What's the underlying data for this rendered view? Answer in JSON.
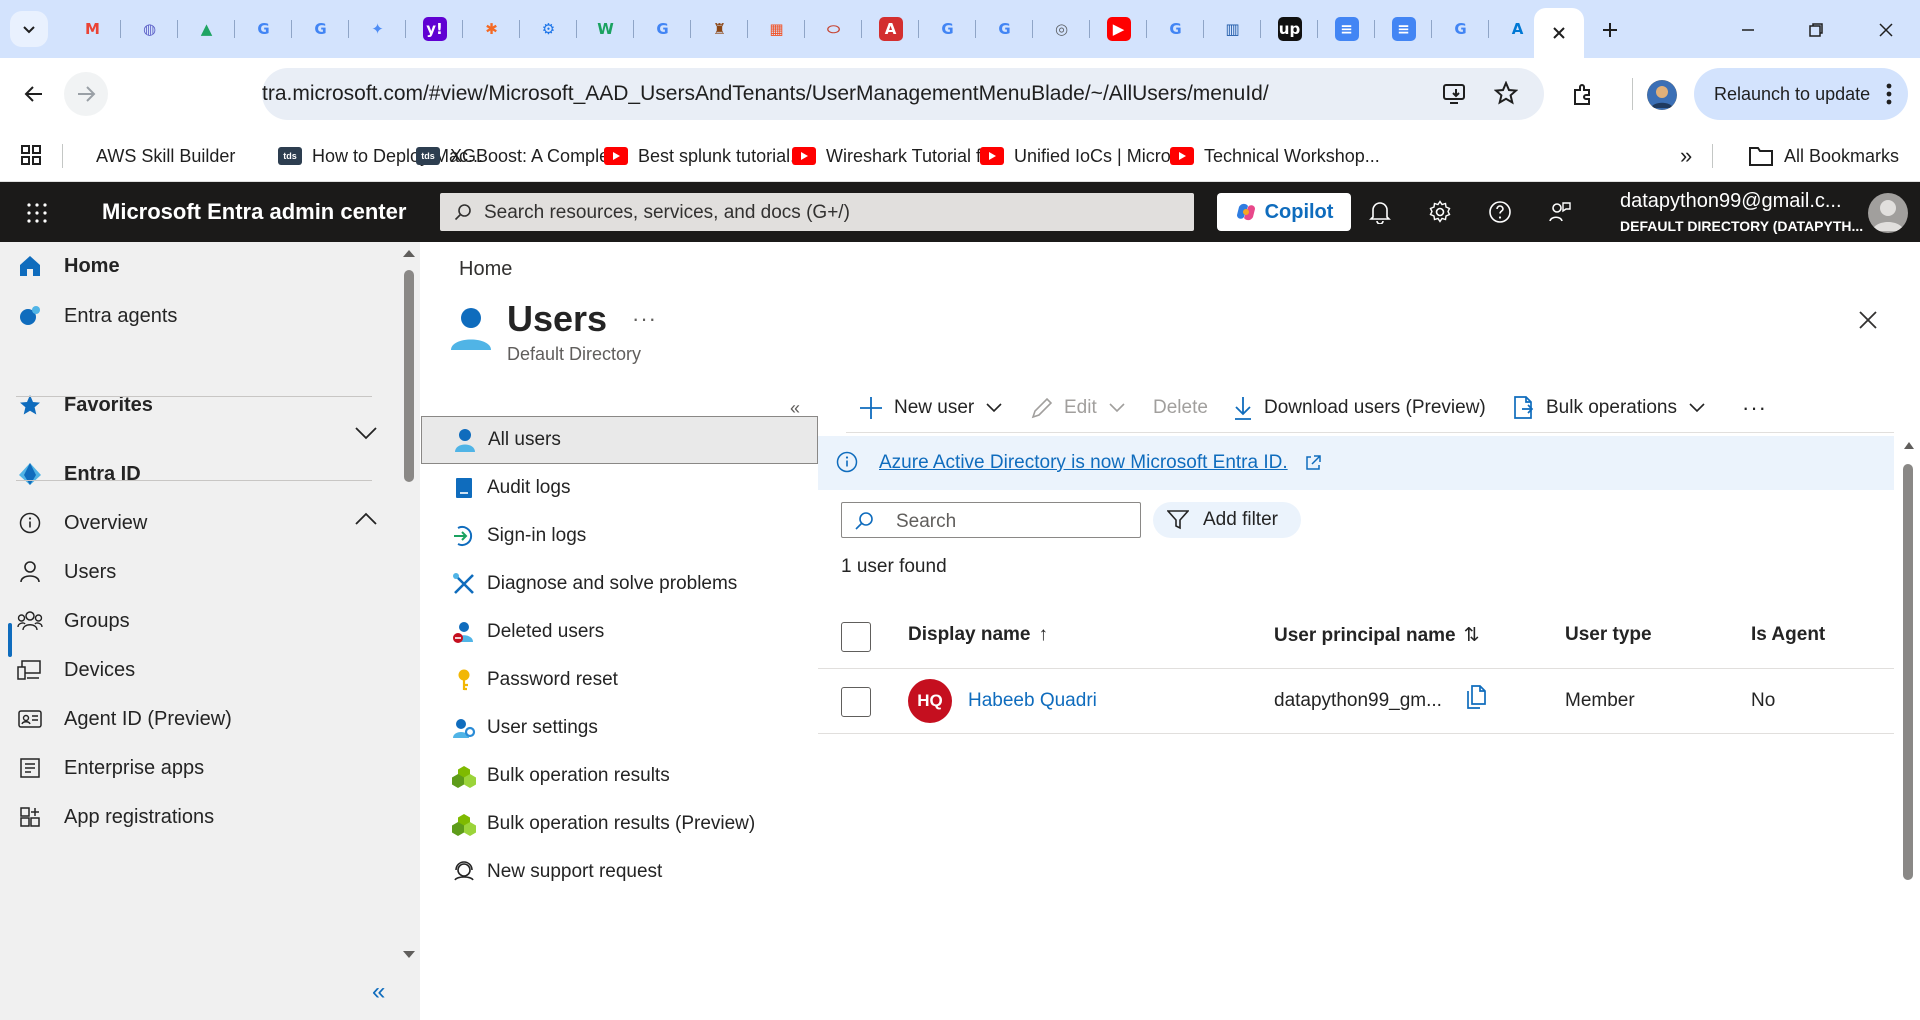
{
  "browser": {
    "tab_favicons": [
      {
        "name": "gmail-icon",
        "glyph": "M",
        "color": "#ea4335",
        "bg": "transparent"
      },
      {
        "name": "globe-icon",
        "glyph": "◍",
        "color": "#5b5fc7",
        "bg": "transparent"
      },
      {
        "name": "google-drive-icon",
        "glyph": "▲",
        "color": "#1fa463",
        "bg": "transparent"
      },
      {
        "name": "google-icon",
        "glyph": "G",
        "color": "#4285f4",
        "bg": "transparent"
      },
      {
        "name": "google-icon",
        "glyph": "G",
        "color": "#4285f4",
        "bg": "transparent"
      },
      {
        "name": "gemini-icon",
        "glyph": "✦",
        "color": "#4f8df5",
        "bg": "transparent"
      },
      {
        "name": "yahoo-icon",
        "glyph": "y!",
        "color": "#ffffff",
        "bg": "#6001d2"
      },
      {
        "name": "puzzle-orange-icon",
        "glyph": "✱",
        "color": "#f46a25",
        "bg": "transparent"
      },
      {
        "name": "settings-blue-icon",
        "glyph": "⚙",
        "color": "#1a73e8",
        "bg": "transparent"
      },
      {
        "name": "w3-icon",
        "glyph": "W",
        "color": "#1aa260",
        "bg": "transparent"
      },
      {
        "name": "google-icon",
        "glyph": "G",
        "color": "#4285f4",
        "bg": "transparent"
      },
      {
        "name": "figure-icon",
        "glyph": "♜",
        "color": "#8b4513",
        "bg": "transparent"
      },
      {
        "name": "microsoft-icon",
        "glyph": "▦",
        "color": "#f25022",
        "bg": "transparent"
      },
      {
        "name": "oracle-icon",
        "glyph": "⬭",
        "color": "#c74634",
        "bg": "transparent"
      },
      {
        "name": "pdf-icon",
        "glyph": "A",
        "color": "#ffffff",
        "bg": "#d32f2f"
      },
      {
        "name": "google-icon",
        "glyph": "G",
        "color": "#4285f4",
        "bg": "transparent"
      },
      {
        "name": "google-lens-icon",
        "glyph": "G",
        "color": "#4285f4",
        "bg": "transparent"
      },
      {
        "name": "chrome-icon",
        "glyph": "◎",
        "color": "#5f6368",
        "bg": "transparent"
      },
      {
        "name": "youtube-icon",
        "glyph": "▶",
        "color": "#ffffff",
        "bg": "#ff0000"
      },
      {
        "name": "google-icon",
        "glyph": "G",
        "color": "#4285f4",
        "bg": "transparent"
      },
      {
        "name": "kaggle-icon",
        "glyph": "▥",
        "color": "#1e5aa8",
        "bg": "transparent"
      },
      {
        "name": "upwork-icon",
        "glyph": "up",
        "color": "#ffffff",
        "bg": "#111111"
      },
      {
        "name": "google-docs-icon",
        "glyph": "≡",
        "color": "#ffffff",
        "bg": "#4285f4"
      },
      {
        "name": "google-docs-icon",
        "glyph": "≡",
        "color": "#ffffff",
        "bg": "#4285f4"
      },
      {
        "name": "google-icon",
        "glyph": "G",
        "color": "#4285f4",
        "bg": "transparent"
      },
      {
        "name": "azure-icon",
        "glyph": "A",
        "color": "#0078d4",
        "bg": "transparent"
      }
    ],
    "url": "tra.microsoft.com/#view/Microsoft_AAD_UsersAndTenants/UserManagementMenuBlade/~/AllUsers/menuId/",
    "relaunch_label": "Relaunch to update",
    "bookmarks": [
      {
        "label": "AWS Skill Builder",
        "icon": "none",
        "color": ""
      },
      {
        "label": "How to Deploy Mac...",
        "icon": "tds",
        "color": "#2d3e50"
      },
      {
        "label": "XGBoost: A Comple...",
        "icon": "tds",
        "color": "#2d3e50"
      },
      {
        "label": "Best splunk tutorial...",
        "icon": "youtube",
        "color": "#ff0000"
      },
      {
        "label": "Wireshark Tutorial f...",
        "icon": "youtube",
        "color": "#ff0000"
      },
      {
        "label": "Unified IoCs | Micro...",
        "icon": "youtube",
        "color": "#ff0000"
      },
      {
        "label": "Technical Workshop...",
        "icon": "youtube",
        "color": "#ff0000"
      }
    ],
    "bookmarks_more": "»",
    "all_bookmarks_label": "All Bookmarks"
  },
  "portal": {
    "title": "Microsoft Entra admin center",
    "search_placeholder": "Search resources, services, and docs (G+/)",
    "copilot_label": "Copilot",
    "account_name": "datapython99@gmail.c...",
    "account_directory": "DEFAULT DIRECTORY (DATAPYTH..."
  },
  "leftnav": {
    "items": [
      {
        "label": "Home",
        "icon": "home-icon",
        "bold": true
      },
      {
        "label": "Entra agents",
        "icon": "entra-agents-icon",
        "bold": false
      },
      {
        "label": "Favorites",
        "icon": "star-icon",
        "bold": true
      },
      {
        "label": "Entra ID",
        "icon": "entra-id-icon",
        "bold": true
      },
      {
        "label": "Overview",
        "icon": "info-icon",
        "bold": false
      },
      {
        "label": "Users",
        "icon": "user-icon",
        "bold": false
      },
      {
        "label": "Groups",
        "icon": "groups-icon",
        "bold": false
      },
      {
        "label": "Devices",
        "icon": "devices-icon",
        "bold": false
      },
      {
        "label": "Agent ID (Preview)",
        "icon": "agent-id-icon",
        "bold": false
      },
      {
        "label": "Enterprise apps",
        "icon": "enterprise-apps-icon",
        "bold": false
      },
      {
        "label": "App registrations",
        "icon": "app-registrations-icon",
        "bold": false
      }
    ],
    "selected": "Users",
    "collapse_glyph": "«"
  },
  "blade": {
    "breadcrumb": "Home",
    "title": "Users",
    "subtitle": "Default Directory",
    "more_glyph": "···",
    "menu": [
      {
        "label": "All users",
        "icon": "all-users-icon"
      },
      {
        "label": "Audit logs",
        "icon": "audit-logs-icon"
      },
      {
        "label": "Sign-in logs",
        "icon": "sign-in-logs-icon"
      },
      {
        "label": "Diagnose and solve problems",
        "icon": "diagnose-icon"
      },
      {
        "label": "Deleted users",
        "icon": "deleted-users-icon"
      },
      {
        "label": "Password reset",
        "icon": "password-reset-icon"
      },
      {
        "label": "User settings",
        "icon": "user-settings-icon"
      },
      {
        "label": "Bulk operation results",
        "icon": "bulk-results-icon"
      },
      {
        "label": "Bulk operation results (Preview)",
        "icon": "bulk-results-preview-icon"
      },
      {
        "label": "New support request",
        "icon": "support-request-icon"
      }
    ],
    "menu_selected": "All users",
    "menu_collapse_glyph": "«",
    "commands": {
      "new_user": "New user",
      "edit": "Edit",
      "delete": "Delete",
      "download": "Download users (Preview)",
      "bulk": "Bulk operations",
      "more": "···"
    },
    "banner_link": "Azure Active Directory is now Microsoft Entra ID.",
    "search_placeholder": "Search",
    "add_filter": "Add filter",
    "result_count": "1 user found",
    "columns": {
      "display_name": "Display name",
      "display_name_sort": "↑",
      "upn": "User principal name",
      "upn_sort": "⇅",
      "user_type": "User type",
      "is_agent": "Is Agent"
    },
    "rows": [
      {
        "initials": "HQ",
        "display_name": "Habeeb Quadri",
        "upn": "datapython99_gm...",
        "user_type": "Member",
        "is_agent": "No"
      }
    ]
  },
  "colors": {
    "accent": "#0f6cbd",
    "header_bg": "#1b1a19",
    "nav_bg": "#f0f0f0",
    "avatar_red": "#c50f1f"
  }
}
